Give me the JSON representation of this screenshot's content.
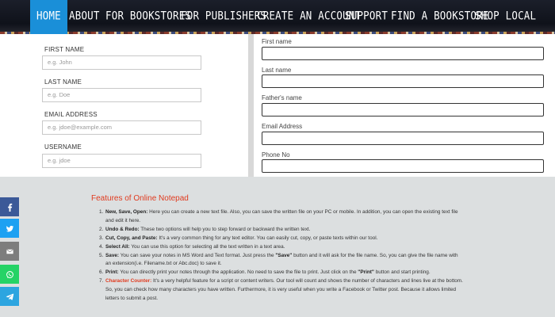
{
  "nav": {
    "items": [
      "HOME",
      "ABOUT",
      "FOR BOOKSTORES",
      "FOR PUBLISHERS",
      "CREATE AN ACCOUNT",
      "SUPPORT",
      "FIND A BOOKSTORE",
      "SHOP LOCAL"
    ],
    "active": "HOME",
    "active_color": "#1a8fd8"
  },
  "left_form": {
    "fields": [
      {
        "label": "FIRST NAME",
        "placeholder": "e.g. John"
      },
      {
        "label": "LAST NAME",
        "placeholder": "e.g. Doe"
      },
      {
        "label": "EMAIL ADDRESS",
        "placeholder": "e.g. jdoe@example.com"
      },
      {
        "label": "USERNAME",
        "placeholder": "e.g. jdoe"
      }
    ]
  },
  "right_form": {
    "fields": [
      {
        "label": "First name",
        "value": ""
      },
      {
        "label": "Last name",
        "value": ""
      },
      {
        "label": "Father's name",
        "value": ""
      },
      {
        "label": "Email Address",
        "value": ""
      },
      {
        "label": "Phone No",
        "value": ""
      }
    ]
  },
  "notepad_info": {
    "title": "Features of Online Notepad",
    "title_color": "#e03a1e",
    "items": [
      {
        "num": "1.",
        "term": "New, Save, Open:",
        "text": " Here you can create a new text file. Also, you can save the written file on your PC or mobile. In addition, you can open the existing text file and edit it here."
      },
      {
        "num": "2.",
        "term": "Undo & Redo:",
        "text": " These two options will help you to step forward or backward the written text."
      },
      {
        "num": "3.",
        "term": "Cut, Copy, and Paste:",
        "text": " It's a very common thing for any text editor. You can easily cut, copy, or paste texts within our tool."
      },
      {
        "num": "4.",
        "term": "Select All:",
        "text": " You can use this option for selecting all the text written in a text area."
      },
      {
        "num": "5.",
        "term": "Save:",
        "text_a": " You can save your notes in MS Word and Text format. Just press the ",
        "quote": "\"Save\"",
        "text_b": " button and it will ask for the file name. So, you can give the file name with an extension(i.e. Filename.txt or Abc.doc) to save it."
      },
      {
        "num": "6.",
        "term": "Print:",
        "text_a": " You can directly print your notes through the application. No need to save the file to print. Just click on the ",
        "quote": "\"Print\"",
        "text_b": " button and start printing."
      },
      {
        "num": "7.",
        "term": "Character Counter:",
        "text": " It's a very helpful feature for a script or content writers. Our tool will count and shows the number of characters and lines live at the bottom. So, you can check how many characters you have written. Furthermore, it is very useful when you write a Facebook or Twitter post. Because it allows limited letters to submit a post."
      }
    ]
  },
  "share_bar": [
    {
      "icon": "facebook-icon",
      "color": "#3b5998"
    },
    {
      "icon": "twitter-icon",
      "color": "#1da1f2"
    },
    {
      "icon": "email-icon",
      "color": "#7d7d7d"
    },
    {
      "icon": "whatsapp-icon",
      "color": "#25d366"
    },
    {
      "icon": "telegram-icon",
      "color": "#2ca5e0"
    }
  ]
}
